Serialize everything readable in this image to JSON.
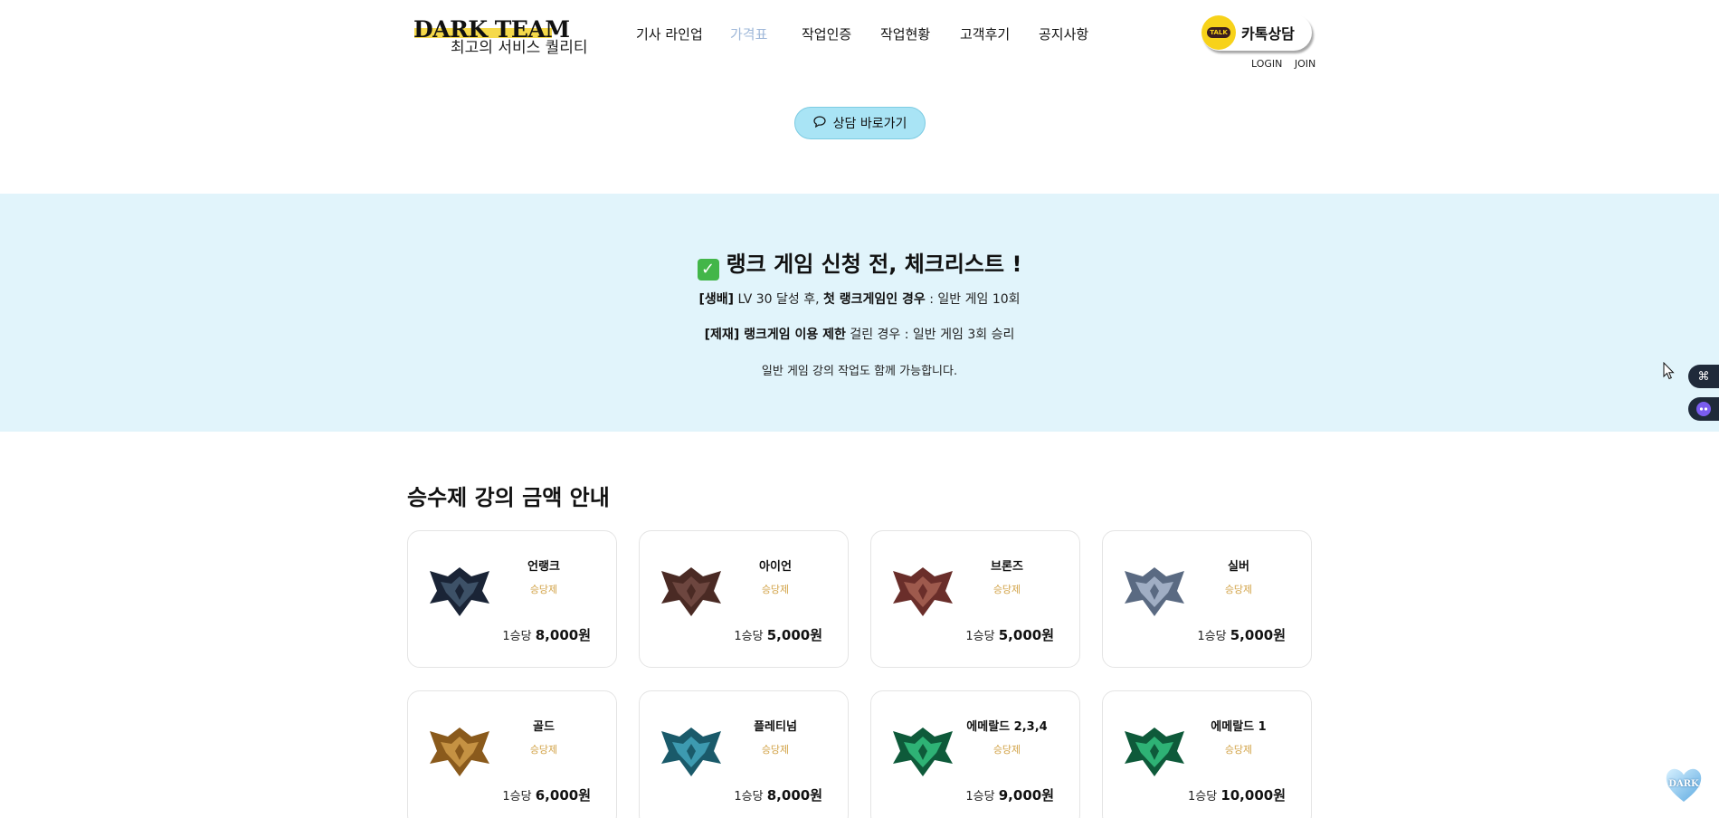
{
  "header": {
    "brand": "DARK TEAM",
    "slogan": "최고의 서비스 퀄리티",
    "nav": [
      "기사 라인업",
      "가격표",
      "작업인증",
      "작업현황",
      "고객후기",
      "공지사항"
    ],
    "active_nav": "가격표",
    "kakao_badge": "TALK",
    "kakao_label": "카톡상담",
    "login": "LOGIN",
    "join": "JOIN"
  },
  "consult_button": "상담 바로가기",
  "checklist": {
    "title": "랭크 게임 신청 전, 체크리스트 !",
    "line1_tag": "[생배]",
    "line1_a": " LV 30 달성 후, ",
    "line1_bold": "첫 랭크게임인 경우",
    "line1_b": " : 일반 게임 10회",
    "line2_tag": "[제재] 랭크게임 이용 제한",
    "line2_rest": " 걸린 경우 : 일반 게임 3회 승리",
    "line3": "일반 게임 강의 작업도 함께 가능합니다."
  },
  "section_title": "승수제 강의 금액 안내",
  "price_prefix": "1승당",
  "cards": [
    {
      "tier": "언랭크",
      "kind": "승당제",
      "price": "8,000원",
      "color": "#1a2436",
      "accent": "#4a6078"
    },
    {
      "tier": "아이언",
      "kind": "승당제",
      "price": "5,000원",
      "color": "#4a2a24",
      "accent": "#7a5048"
    },
    {
      "tier": "브론즈",
      "kind": "승당제",
      "price": "5,000원",
      "color": "#6a2e2a",
      "accent": "#b06a5a"
    },
    {
      "tier": "실버",
      "kind": "승당제",
      "price": "5,000원",
      "color": "#5a6a82",
      "accent": "#b8c6da"
    },
    {
      "tier": "골드",
      "kind": "승당제",
      "price": "6,000원",
      "color": "#8a5a1c",
      "accent": "#d8a650"
    },
    {
      "tier": "플레티넘",
      "kind": "승당제",
      "price": "8,000원",
      "color": "#1a5a6a",
      "accent": "#4ab0c8"
    },
    {
      "tier": "에메랄드 2,3,4",
      "kind": "승당제",
      "price": "9,000원",
      "color": "#0e5a3a",
      "accent": "#3ad08a"
    },
    {
      "tier": "에메랄드 1",
      "kind": "승당제",
      "price": "10,000원",
      "color": "#0e5a3a",
      "accent": "#3ad08a"
    }
  ],
  "floating_widget": "DARK"
}
